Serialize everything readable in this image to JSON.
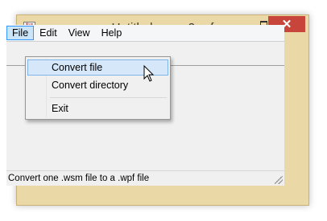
{
  "window": {
    "title": "Untitled - wsm2wpf",
    "icon_text": "Wsm Wpf",
    "close_glyph": "✕"
  },
  "menubar": {
    "items": [
      {
        "label": "File"
      },
      {
        "label": "Edit"
      },
      {
        "label": "View"
      },
      {
        "label": "Help"
      }
    ]
  },
  "file_menu": {
    "items": [
      {
        "label": "Convert file"
      },
      {
        "label": "Convert directory"
      },
      {
        "label": "Exit"
      }
    ]
  },
  "statusbar": {
    "text": "Convert one .wsm file to a .wpf file"
  },
  "colors": {
    "title_bar": "#ead8a6",
    "close_button": "#c7453a",
    "menu_highlight": "#cce4f7"
  }
}
